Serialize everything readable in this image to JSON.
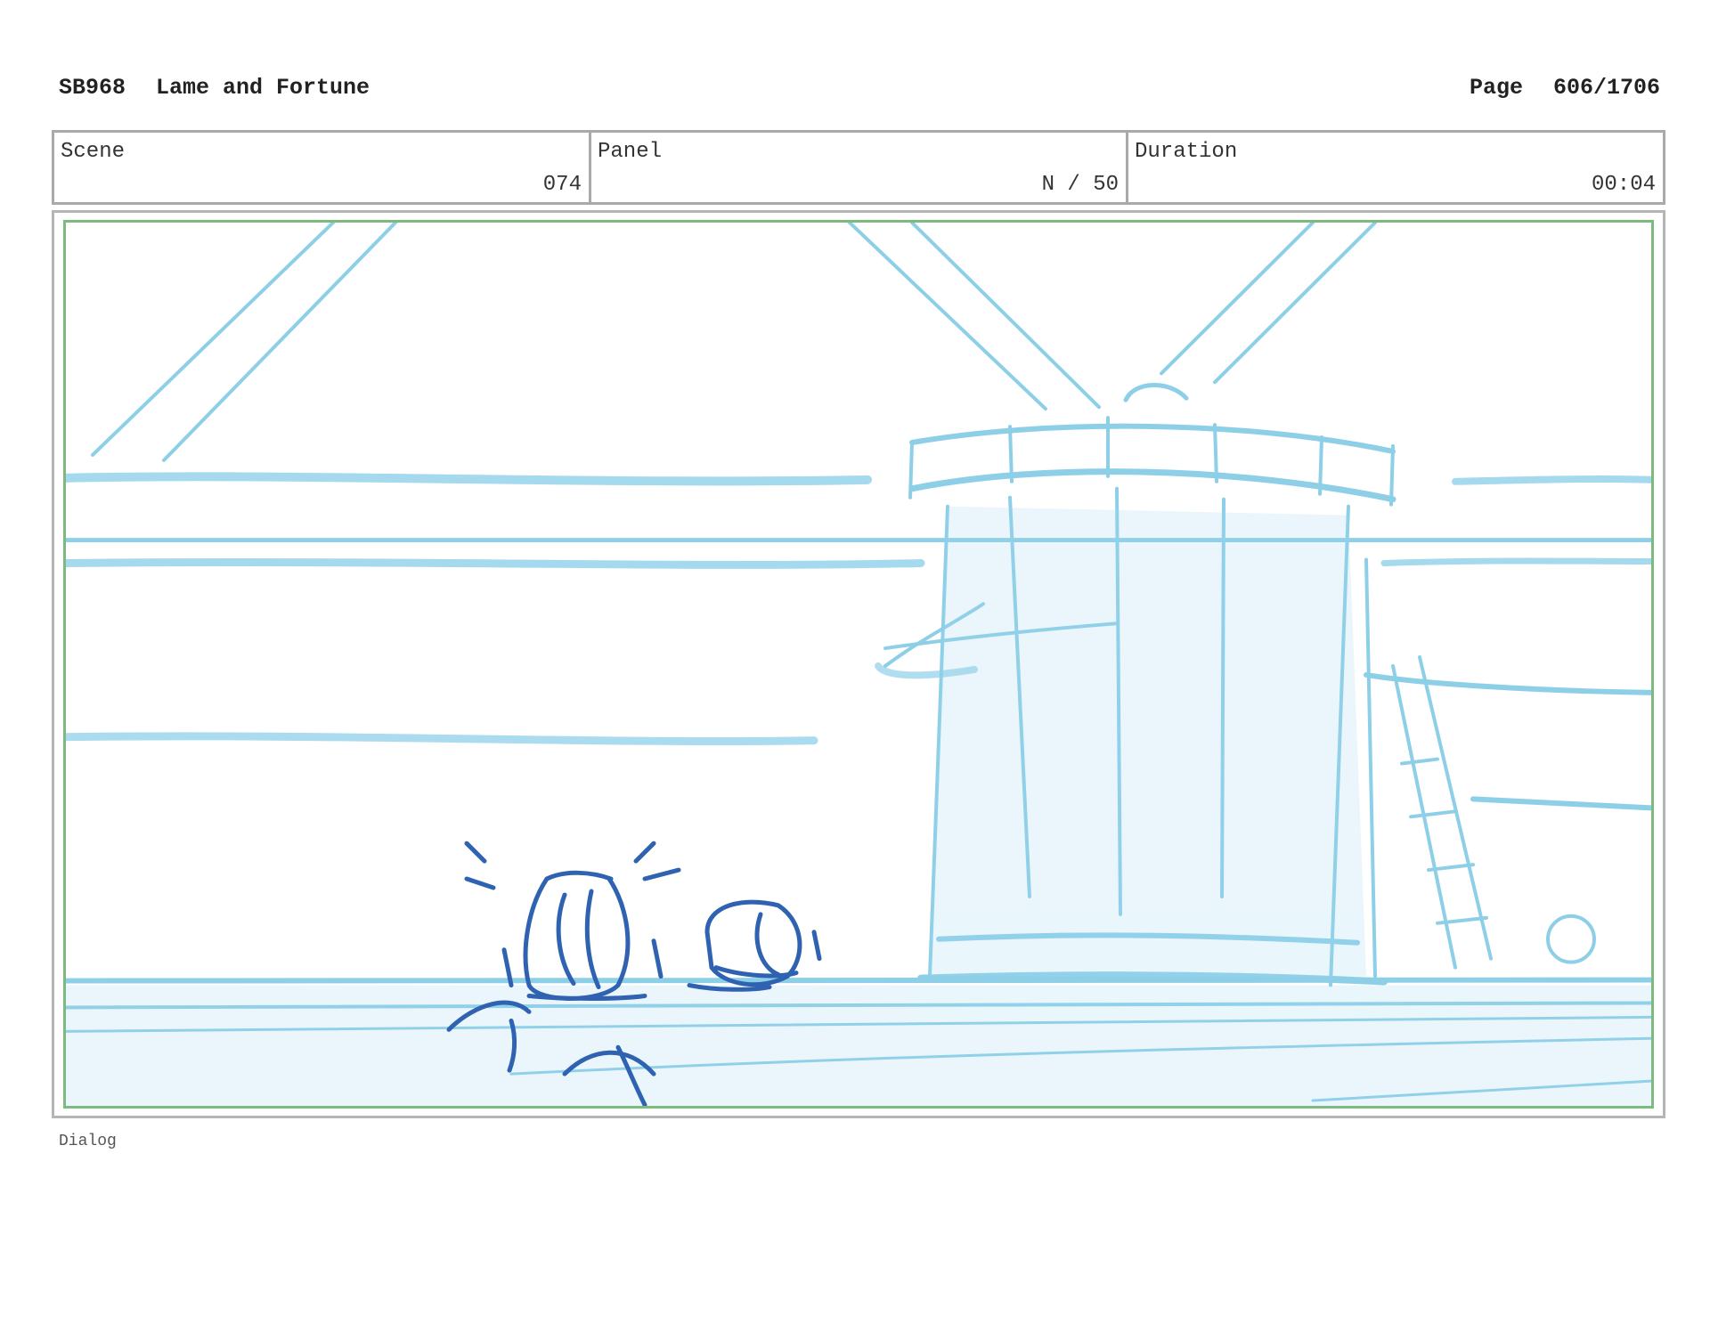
{
  "header": {
    "code": "SB968",
    "title": "Lame and Fortune",
    "page_label": "Page",
    "page_number": "606/1706"
  },
  "info_bar": {
    "scene_label": "Scene",
    "scene_value": "074",
    "panel_label": "Panel",
    "panel_value": "N / 50",
    "duration_label": "Duration",
    "duration_value": "00:04"
  },
  "dialog": {
    "label": "Dialog"
  },
  "colors": {
    "sketch_light": "#8ecfe8",
    "sketch_dark": "#2f62b0",
    "frame_border": "#7dba7d",
    "cell_border": "#a9a9a9"
  }
}
